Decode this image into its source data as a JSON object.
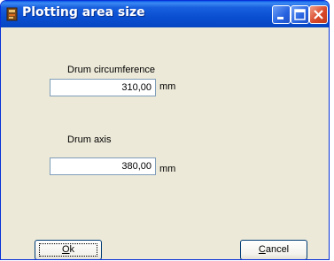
{
  "window": {
    "title": "Plotting area size",
    "icon": "app-icon",
    "controls": [
      "minimize-icon",
      "maximize-icon",
      "close-icon"
    ]
  },
  "drum_circumference": {
    "label": "Drum circumference",
    "value": "310,00",
    "unit": "mm"
  },
  "drum_axis": {
    "label": "Drum axis",
    "value": "380,00",
    "unit": "mm"
  },
  "buttons": {
    "ok": {
      "mnemonic": "O",
      "rest": "k"
    },
    "cancel": {
      "mnemonic": "C",
      "rest": "ancel"
    }
  }
}
